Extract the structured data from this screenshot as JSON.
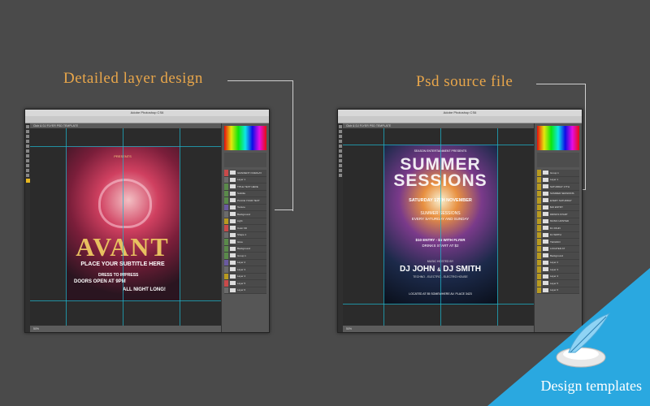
{
  "captions": {
    "left": "Detailed layer design",
    "right": "Psd source file",
    "corner": "Design templates"
  },
  "left_window": {
    "title": "Adobe Photoshop CS6",
    "doc_tab": "Club & DJ FLYER PSD TEMPLATE",
    "zoom": "50%",
    "poster": {
      "kicker": "PRESENTS",
      "title": "AVANT",
      "subtitle": "PLACE YOUR SUBTITLE HERE",
      "line1": "DRESS TO IMPRESS",
      "line2": "DOORS OPEN AT 9PM",
      "line3": "ALL NIGHT LONG!"
    },
    "layers": [
      "GRADIENT OVERLAY",
      "Layer 1",
      "TITLE TEXT HERE",
      "Subtitle",
      "PLACE YOUR TEXT",
      "Texture",
      "Background",
      "Light",
      "Color Fill",
      "Shape 1",
      "Glow",
      "Background",
      "Group 1",
      "Layer 2",
      "Layer 3",
      "Layer 4",
      "Layer 5",
      "Layer 6"
    ]
  },
  "right_window": {
    "title": "Adobe Photoshop CS6",
    "doc_tab": "Club & DJ FLYER PSD TEMPLATE",
    "zoom": "50%",
    "poster": {
      "presents": "SEASON ENTERTAINMENT PRESENTS",
      "title1": "SUMMER",
      "title2": "SESSIONS",
      "date": "SATURDAY 17TH NOVEMBER",
      "event": "SUMMER SESSIONS",
      "every": "EVERY SATURDAY AND SUNDAY",
      "entry": "$10 ENTRY  -  $5 WITH FLYER",
      "drinks": "DRINKS START AT $2",
      "hosted": "MUSIC HOSTED BY",
      "djs_a": "DJ JOHN",
      "djs_amp": "&",
      "djs_b": "DJ SMITH",
      "genres": "TECHNO - ELECTRO - ELECTRO HOUSE",
      "location": "LOCATED AT 55 SOMEWHERE AV. PLACE 3423"
    },
    "layers": [
      "Group 1",
      "Layer 1",
      "SATURDAY 17TH",
      "SUMMER SESSIONS",
      "EVERY SATURDAY",
      "$10 ENTRY",
      "DRINKS START",
      "MUSIC HOSTED",
      "DJ JOHN",
      "DJ SMITH",
      "TECHNO",
      "LOCATED AT",
      "Background",
      "Layer 2",
      "Layer 3",
      "Layer 4",
      "Layer 5",
      "Layer 6"
    ]
  },
  "colors": {
    "accent": "#e8a64a",
    "corner": "#2aa8e0",
    "guide": "#1fb3c9"
  }
}
